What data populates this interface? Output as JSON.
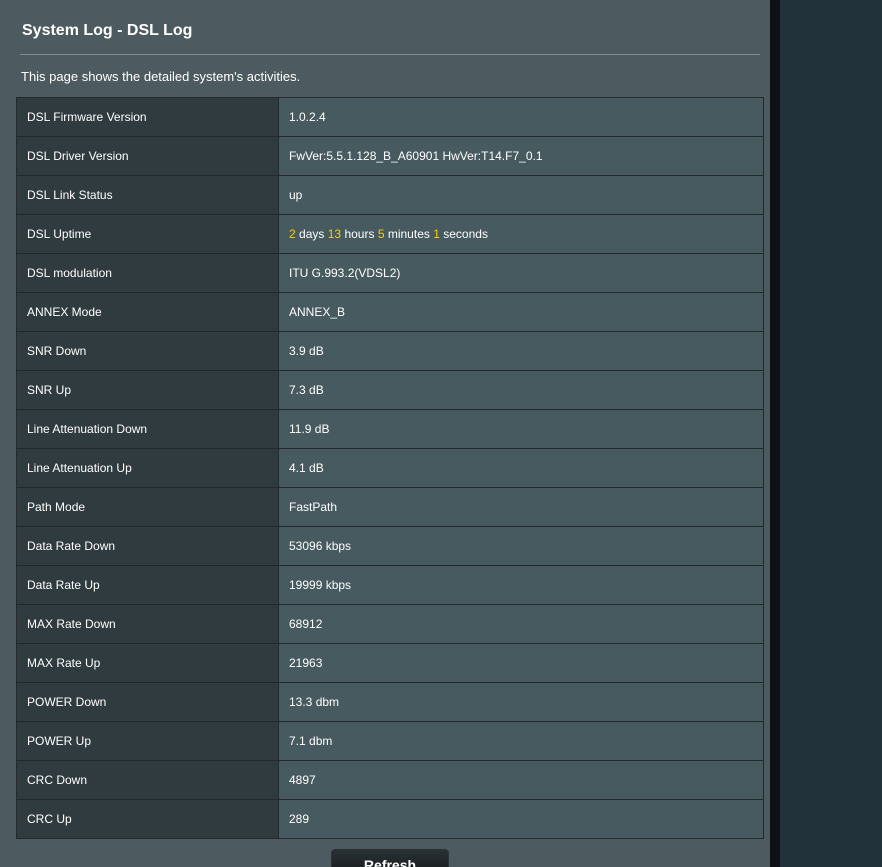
{
  "page": {
    "title": "System Log - DSL Log",
    "description": "This page shows the detailed system's activities."
  },
  "rows": [
    {
      "label": "DSL Firmware Version",
      "value": "1.0.2.4"
    },
    {
      "label": "DSL Driver Version",
      "value": "FwVer:5.5.1.128_B_A60901 HwVer:T14.F7_0.1"
    },
    {
      "label": "DSL Link Status",
      "value": "up"
    },
    {
      "label": "DSL Uptime",
      "value": ""
    },
    {
      "label": "DSL modulation",
      "value": "ITU G.993.2(VDSL2)"
    },
    {
      "label": "ANNEX Mode",
      "value": "ANNEX_B"
    },
    {
      "label": "SNR Down",
      "value": "3.9 dB"
    },
    {
      "label": "SNR Up",
      "value": "7.3 dB"
    },
    {
      "label": "Line Attenuation Down",
      "value": "11.9 dB"
    },
    {
      "label": "Line Attenuation Up",
      "value": "4.1 dB"
    },
    {
      "label": "Path Mode",
      "value": "FastPath"
    },
    {
      "label": "Data Rate Down",
      "value": "53096 kbps"
    },
    {
      "label": "Data Rate Up",
      "value": "19999 kbps"
    },
    {
      "label": "MAX Rate Down",
      "value": "68912"
    },
    {
      "label": "MAX Rate Up",
      "value": "21963"
    },
    {
      "label": "POWER Down",
      "value": "13.3 dbm"
    },
    {
      "label": "POWER Up",
      "value": "7.1 dbm"
    },
    {
      "label": "CRC Down",
      "value": "4897"
    },
    {
      "label": "CRC Up",
      "value": "289"
    }
  ],
  "uptime": {
    "days": "2",
    "days_unit": "days",
    "hours": "13",
    "hours_unit": "hours",
    "minutes": "5",
    "minutes_unit": "minutes",
    "seconds": "1",
    "seconds_unit": "seconds"
  },
  "actions": {
    "refresh_label": "Refresh"
  },
  "colors": {
    "panel_bg": "#4d5b60",
    "label_cell_bg": "#303b3f",
    "value_cell_bg": "#475a60",
    "highlight_number": "#ffcc00"
  }
}
